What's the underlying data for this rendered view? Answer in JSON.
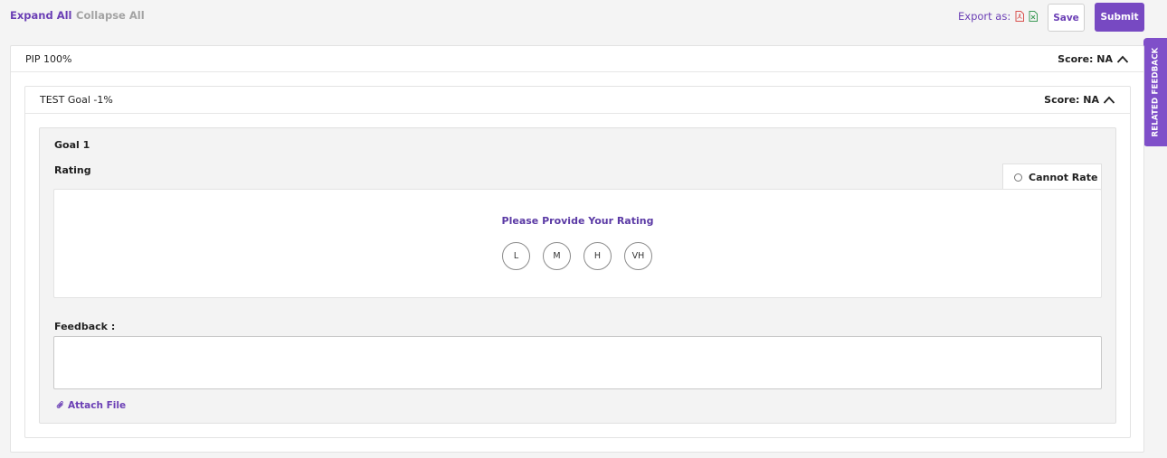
{
  "toolbar": {
    "expand_all": "Expand All",
    "collapse_all": "Collapse All",
    "export_label": "Export as:",
    "export_icons": [
      "pdf-icon",
      "excel-icon"
    ],
    "save": "Save",
    "submit": "Submit"
  },
  "side_tab": {
    "label": "RELATED FEEDBACK"
  },
  "section": {
    "title": "PIP 100%",
    "score": "Score: NA",
    "goal_group": {
      "title": "TEST Goal -1%",
      "score": "Score: NA",
      "goal": {
        "title": "Goal 1",
        "rating_label": "Rating",
        "cannot_rate": "Cannot Rate",
        "rating_prompt": "Please Provide Your Rating",
        "rating_options": [
          "L",
          "M",
          "H",
          "VH"
        ],
        "feedback_label": "Feedback :",
        "feedback_value": "",
        "attach_file": "Attach File"
      }
    }
  },
  "colors": {
    "accent": "#7749c2",
    "accent_text": "#6b3fb5",
    "muted_text": "#a3a3a3",
    "background": "#f4f4f4"
  }
}
